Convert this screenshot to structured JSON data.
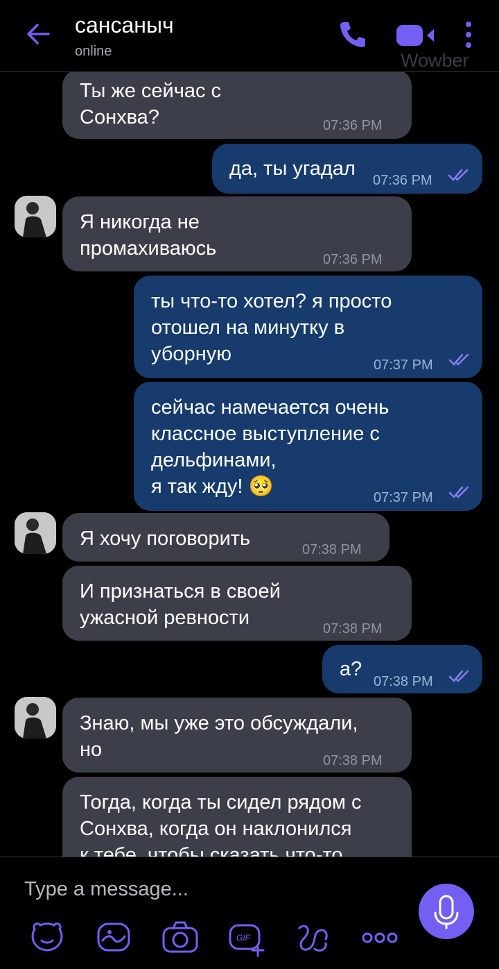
{
  "header": {
    "title": "сансаныч",
    "status": "online",
    "watermark": "Wowber"
  },
  "colors": {
    "accent": "#7360f2",
    "incoming_bubble": "#3c3f4a",
    "outgoing_bubble": "#163b6c",
    "background": "#000000"
  },
  "messages": [
    {
      "direction": "in",
      "text": "Ты же сейчас с\nСонхва?",
      "time": "07:36 PM"
    },
    {
      "direction": "out",
      "text": "да, ты угадал",
      "time": "07:36 PM"
    },
    {
      "direction": "in",
      "text": "Я никогда не\nпромахиваюсь",
      "time": "07:36 PM"
    },
    {
      "direction": "out",
      "text": "ты что-то хотел? я просто\nотошел на минутку в\nуборную",
      "time": "07:37 PM"
    },
    {
      "direction": "out",
      "text": "сейчас намечается очень\nклассное выступление с\nдельфинами,\nя так жду! 🥺",
      "time": "07:37 PM"
    },
    {
      "direction": "in",
      "text": "Я хочу поговорить",
      "time": "07:38 PM"
    },
    {
      "direction": "in",
      "text": "И признаться в своей\nужасной ревности",
      "time": "07:38 PM"
    },
    {
      "direction": "out",
      "text": "а?",
      "time": "07:38 PM"
    },
    {
      "direction": "in",
      "text": "Знаю, мы уже это обсуждали,\nно",
      "time": "07:38 PM"
    },
    {
      "direction": "in",
      "text": "Тогда, когда ты сидел рядом с\nСонхва, когда он наклонился\nк тебе, чтобы сказать что-то",
      "time": ""
    }
  ],
  "composer": {
    "placeholder": "Type a message..."
  },
  "toolbar": {
    "icons": [
      "sticker-icon",
      "doodle-icon",
      "camera-icon",
      "gif-icon",
      "lens-icon",
      "more-options-icon"
    ]
  }
}
